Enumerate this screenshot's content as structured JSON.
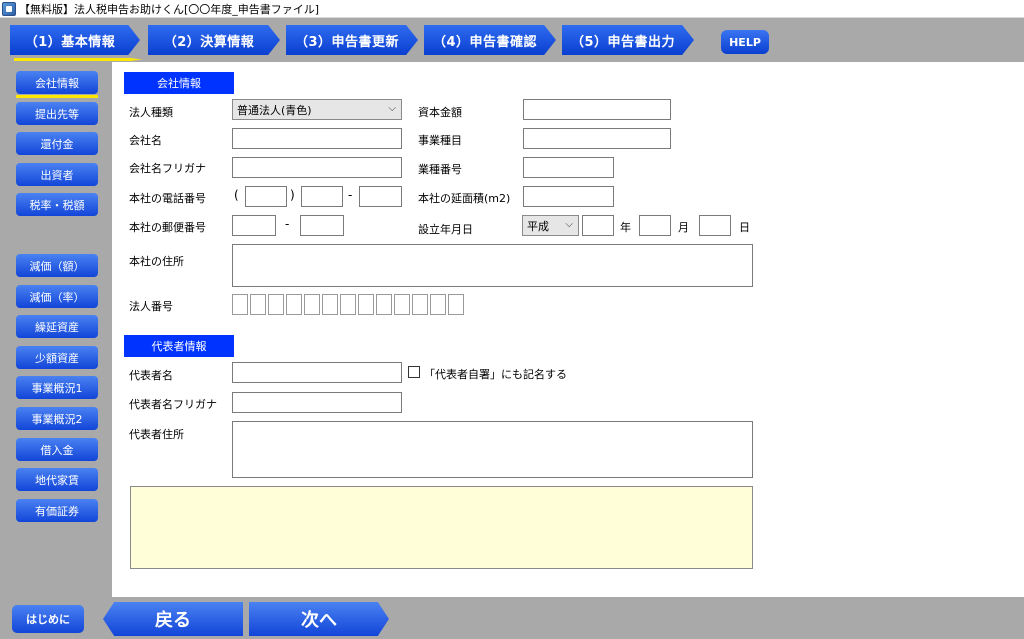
{
  "window": {
    "title": "【無料版】法人税申告お助けくん[〇〇年度_申告書ファイル]"
  },
  "tabs": [
    {
      "label": "（1）基本情報"
    },
    {
      "label": "（2）決算情報"
    },
    {
      "label": "（3）申告書更新"
    },
    {
      "label": "（4）申告書確認"
    },
    {
      "label": "（5）申告書出力"
    }
  ],
  "help": {
    "label": "HELP"
  },
  "sidebar": {
    "items": [
      {
        "label": "会社情報"
      },
      {
        "label": "提出先等"
      },
      {
        "label": "還付金"
      },
      {
        "label": "出資者"
      },
      {
        "label": "税率・税額"
      },
      {
        "label": "減価（額）"
      },
      {
        "label": "減価（率）"
      },
      {
        "label": "繰延資産"
      },
      {
        "label": "少額資産"
      },
      {
        "label": "事業概況1"
      },
      {
        "label": "事業概況2"
      },
      {
        "label": "借入金"
      },
      {
        "label": "地代家賃"
      },
      {
        "label": "有価証券"
      }
    ]
  },
  "company": {
    "section_title": "会社情報",
    "corp_type_label": "法人種類",
    "corp_type_value": "普通法人(青色)",
    "name_label": "会社名",
    "kana_label": "会社名フリガナ",
    "phone_label": "本社の電話番号",
    "postal_label": "本社の郵便番号",
    "address_label": "本社の住所",
    "corp_number_label": "法人番号",
    "capital_label": "資本金額",
    "business_label": "事業種目",
    "industry_code_label": "業種番号",
    "floor_area_label": "本社の延面積(m2)",
    "established_label": "設立年月日",
    "era_value": "平成",
    "year_unit": "年",
    "month_unit": "月",
    "day_unit": "日",
    "paren_open": "(",
    "paren_close": ")",
    "dash": "-"
  },
  "representative": {
    "section_title": "代表者情報",
    "name_label": "代表者名",
    "sign_checkbox_label": "「代表者自署」にも記名する",
    "kana_label": "代表者名フリガナ",
    "address_label": "代表者住所"
  },
  "footer": {
    "start_label": "はじめに",
    "back_label": "戻る",
    "next_label": "次へ"
  }
}
